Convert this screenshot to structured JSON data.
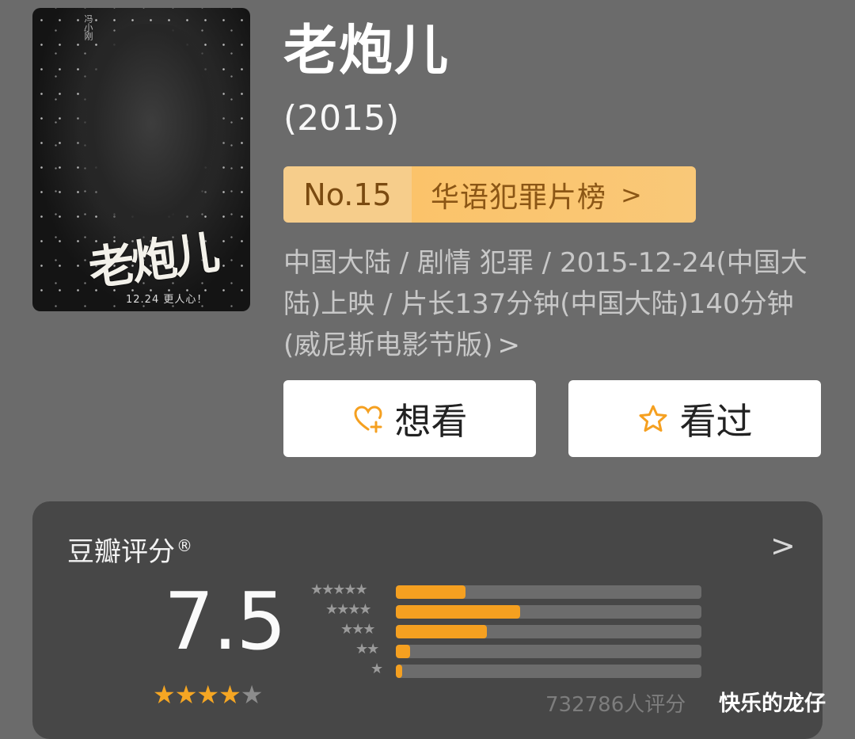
{
  "movie": {
    "title": "老炮儿",
    "year": "(2015)",
    "poster": {
      "title": "老炮儿",
      "date": "12.24 更人心！",
      "credit": "冯小刚"
    },
    "rank": {
      "number": "No.15",
      "list": "华语犯罪片榜",
      "chevron": ">"
    },
    "meta": "中国大陆 / 剧情 犯罪 / 2015-12-24(中国大陆)上映 / 片长137分钟(中国大陆)140分钟(威尼斯电影节版)",
    "meta_chevron": ">"
  },
  "actions": {
    "want": {
      "label": "想看",
      "icon": "heart-plus-icon"
    },
    "seen": {
      "label": "看过",
      "icon": "star-outline-icon"
    }
  },
  "rating": {
    "label": "豆瓣评分",
    "registered_mark": "®",
    "chevron": ">",
    "score": "7.5",
    "avg_stars": 4,
    "distribution": [
      {
        "stars": "★★★★★",
        "fraction": 0.227
      },
      {
        "stars": "★★★★",
        "fraction": 0.407
      },
      {
        "stars": "★★★",
        "fraction": 0.297
      },
      {
        "stars": "★★",
        "fraction": 0.047
      },
      {
        "stars": "★",
        "fraction": 0.022
      }
    ],
    "count": "732786人评分"
  },
  "watermark": "快乐的龙仔",
  "colors": {
    "accent": "#f5a020",
    "rank_bg": "#fbc36a",
    "background": "#6b6b6b",
    "card": "#474747"
  }
}
